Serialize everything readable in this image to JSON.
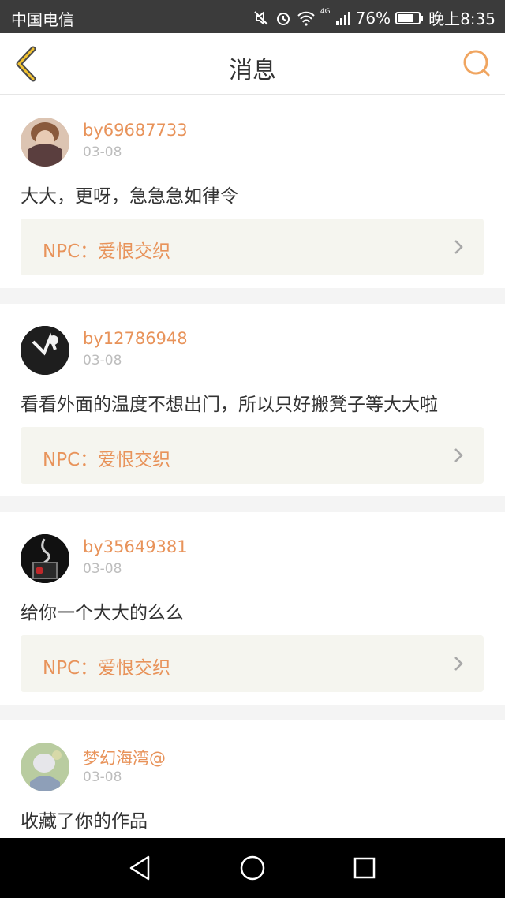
{
  "status_bar": {
    "carrier": "中国电信",
    "network": "4G",
    "battery": "76%",
    "time": "晚上8:35",
    "icons": [
      "mute-icon",
      "alarm-icon",
      "wifi-icon",
      "signal-icon",
      "battery-icon"
    ]
  },
  "header": {
    "title": "消息",
    "back_icon": "back-chevron-icon",
    "search_icon": "search-icon"
  },
  "accent_color": "#e8935a",
  "messages": [
    {
      "username": "by69687733",
      "date": "03-08",
      "text": "大大，更呀，急急急如律令",
      "npc": "NPC：爱恨交织"
    },
    {
      "username": "by12786948",
      "date": "03-08",
      "text": "看看外面的温度不想出门，所以只好搬凳子等大大啦",
      "npc": "NPC：爱恨交织"
    },
    {
      "username": "by35649381",
      "date": "03-08",
      "text": "给你一个大大的么么",
      "npc": "NPC：爱恨交织"
    },
    {
      "username": "梦幻海湾@",
      "date": "03-08",
      "text": "收藏了你的作品"
    }
  ],
  "nav_bar": {
    "icons": [
      "back-triangle-icon",
      "home-circle-icon",
      "recents-square-icon"
    ]
  }
}
